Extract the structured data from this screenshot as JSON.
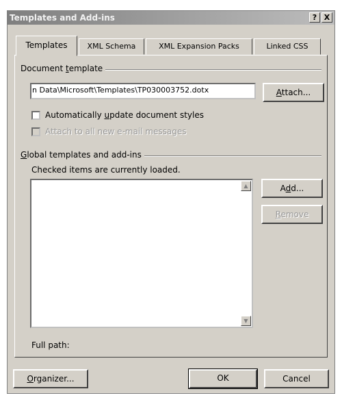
{
  "window": {
    "title": "Templates and Add-ins",
    "help_btn": "?",
    "close_btn": "X"
  },
  "tabs": [
    "Templates",
    "XML Schema",
    "XML Expansion Packs",
    "Linked CSS"
  ],
  "document_template": {
    "group_label_pre": "Document ",
    "group_label_u": "t",
    "group_label_post": "emplate",
    "path_value": "n Data\\Microsoft\\Templates\\TP030003752.dotx",
    "attach_pre": "",
    "attach_u": "A",
    "attach_post": "ttach..."
  },
  "auto_update": {
    "label_pre": "Automatically ",
    "label_u": "u",
    "label_post": "pdate document styles",
    "checked": false
  },
  "attach_email": {
    "label": "Attach to all new e-mail messages",
    "checked": false,
    "enabled": false
  },
  "global": {
    "group_label_u": "G",
    "group_label_post": "lobal templates and add-ins",
    "note": "Checked items are currently loaded.",
    "add_pre": "A",
    "add_u": "d",
    "add_post": "d...",
    "remove_pre": "",
    "remove_u": "R",
    "remove_post": "emove",
    "full_path_label": "Full path:"
  },
  "footer": {
    "organizer_u": "O",
    "organizer_post": "rganizer...",
    "ok": "OK",
    "cancel": "Cancel"
  },
  "colors": {
    "face": "#d4d0c8",
    "titlebar_start": "#7f7f7f",
    "titlebar_end": "#bdbdbd",
    "disabled_text": "#9a9a9a"
  }
}
